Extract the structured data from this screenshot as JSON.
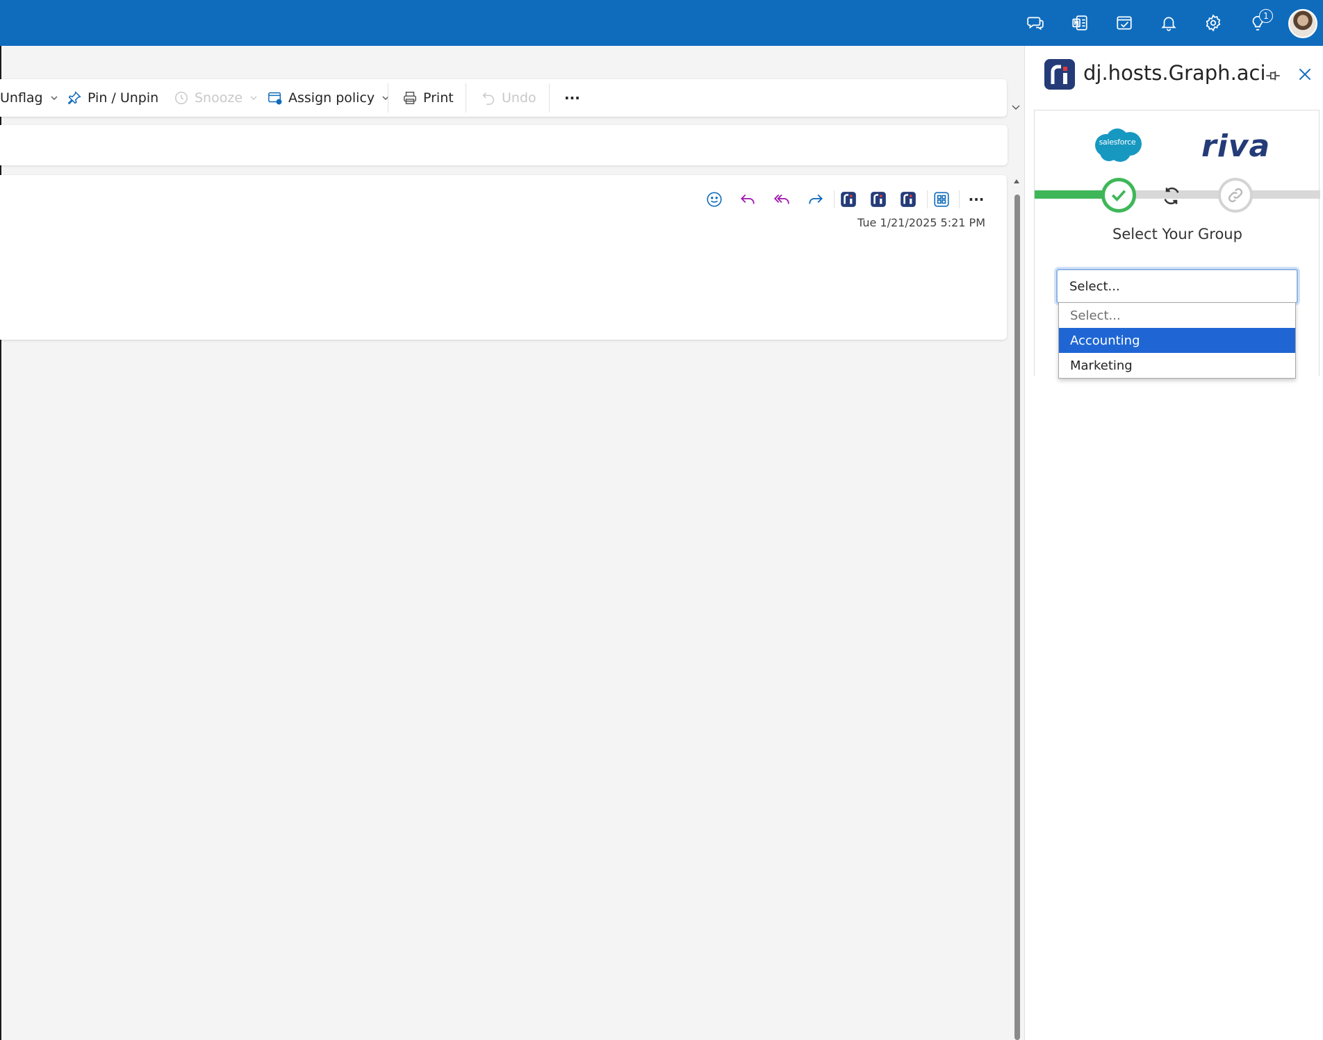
{
  "topbar": {
    "icons": [
      "chat-icon",
      "onenote-icon",
      "todo-icon",
      "bell-icon",
      "gear-icon",
      "lightbulb-icon",
      "avatar"
    ],
    "notification_count": "1",
    "colors": {
      "background": "#0f6cbd"
    }
  },
  "ribbon": {
    "unflag_label": "Unflag",
    "pin_label": "Pin / Unpin",
    "snooze_label": "Snooze",
    "assign_policy_label": "Assign policy",
    "print_label": "Print",
    "undo_label": "Undo",
    "more_label": "···"
  },
  "message": {
    "actions": [
      "emoji-icon",
      "reply-icon",
      "reply-all-icon",
      "forward-icon",
      "riva-icon",
      "riva-icon",
      "riva-icon",
      "apps-icon",
      "more-icon"
    ],
    "more_label": "···",
    "date": "Tue 1/21/2025 5:21 PM"
  },
  "pane": {
    "title": "dj.hosts.Graph.aci",
    "addin": {
      "salesforce_text": "salesforce",
      "riva_text": "riva",
      "heading": "Select Your Group",
      "select": {
        "value": "Select...",
        "options": [
          "Select...",
          "Accounting",
          "Marketing"
        ],
        "highlighted": "Accounting"
      },
      "colors": {
        "progress": "#3fb758",
        "highlight": "#1f66d4",
        "brand": "#243b78",
        "salesforce": "#1798c1"
      }
    }
  }
}
